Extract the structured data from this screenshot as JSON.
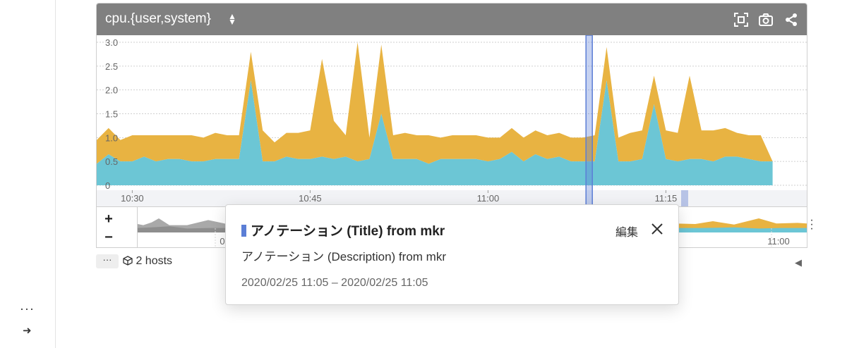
{
  "rail": {
    "more": "···",
    "arrow": "➜"
  },
  "graph": {
    "title": "cpu.{user,system}",
    "sort_icon": "sort-icon",
    "header_icons": [
      "fullscreen-icon",
      "camera-icon",
      "share-icon"
    ],
    "colors": {
      "header": "#808080",
      "user": "#e8b342",
      "system": "#6cc6d5",
      "annotation": "#5b7ed6",
      "overview_gray": "#a9a9a9"
    }
  },
  "chart_data": {
    "type": "area",
    "stacked": true,
    "ylim": [
      0,
      3.0
    ],
    "y_ticks": [
      "3.0",
      "2.5",
      "2.0",
      "1.5",
      "1.0",
      "0.5",
      "0"
    ],
    "x_ticks": [
      "10:30",
      "10:45",
      "11:00",
      "11:15"
    ],
    "x_minutes": [
      27,
      28,
      29,
      30,
      31,
      32,
      33,
      34,
      35,
      36,
      37,
      38,
      39,
      40,
      41,
      42,
      43,
      44,
      45,
      46,
      47,
      48,
      49,
      50,
      51,
      52,
      53,
      54,
      55,
      56,
      57,
      58,
      59,
      60,
      61,
      62,
      63,
      64,
      65,
      66,
      67,
      68,
      69,
      70,
      71,
      72,
      73,
      74,
      75,
      76,
      77,
      78,
      79,
      80,
      81,
      82,
      83,
      84
    ],
    "series": [
      {
        "values": [
          0.45,
          0.65,
          0.5,
          0.5,
          0.6,
          0.5,
          0.55,
          0.55,
          0.5,
          0.5,
          0.55,
          0.55,
          0.55,
          2.2,
          0.5,
          0.5,
          0.6,
          0.55,
          0.55,
          0.6,
          0.55,
          0.6,
          0.5,
          0.55,
          1.5,
          0.55,
          0.55,
          0.55,
          0.45,
          0.55,
          0.55,
          0.55,
          0.55,
          0.5,
          0.55,
          0.7,
          0.5,
          0.65,
          0.55,
          0.6,
          0.5,
          0.5,
          0.5,
          2.2,
          0.5,
          0.5,
          0.55,
          1.7,
          0.55,
          0.5,
          0.55,
          0.55,
          0.5,
          0.6,
          0.6,
          0.55,
          0.5,
          0.5
        ]
      },
      {
        "values": [
          0.5,
          0.55,
          0.45,
          0.55,
          0.45,
          0.55,
          0.5,
          0.5,
          0.55,
          0.5,
          0.55,
          0.5,
          0.5,
          0.6,
          0.65,
          0.4,
          0.5,
          0.55,
          0.6,
          2.05,
          0.8,
          0.45,
          2.5,
          0.45,
          1.45,
          0.5,
          0.55,
          0.5,
          0.6,
          0.45,
          0.5,
          0.5,
          0.5,
          0.5,
          0.45,
          0.5,
          0.5,
          0.5,
          0.5,
          0.5,
          0.5,
          0.5,
          0.55,
          0.7,
          0.5,
          0.6,
          0.6,
          0.6,
          0.6,
          0.6,
          1.75,
          0.6,
          0.65,
          0.6,
          0.5,
          0.5,
          0.55,
          0.0
        ]
      }
    ],
    "annotation_minute": 68.5
  },
  "overview": {
    "x_ticks": [
      "0",
      "11:00"
    ]
  },
  "below": {
    "more_label": "···",
    "hosts_label": "2 hosts"
  },
  "popup": {
    "title": "アノテーション (Title) from mkr",
    "edit_label": "編集",
    "description": "アノテーション (Description) from mkr",
    "time_range": "2020/02/25 11:05 – 2020/02/25 11:05"
  }
}
